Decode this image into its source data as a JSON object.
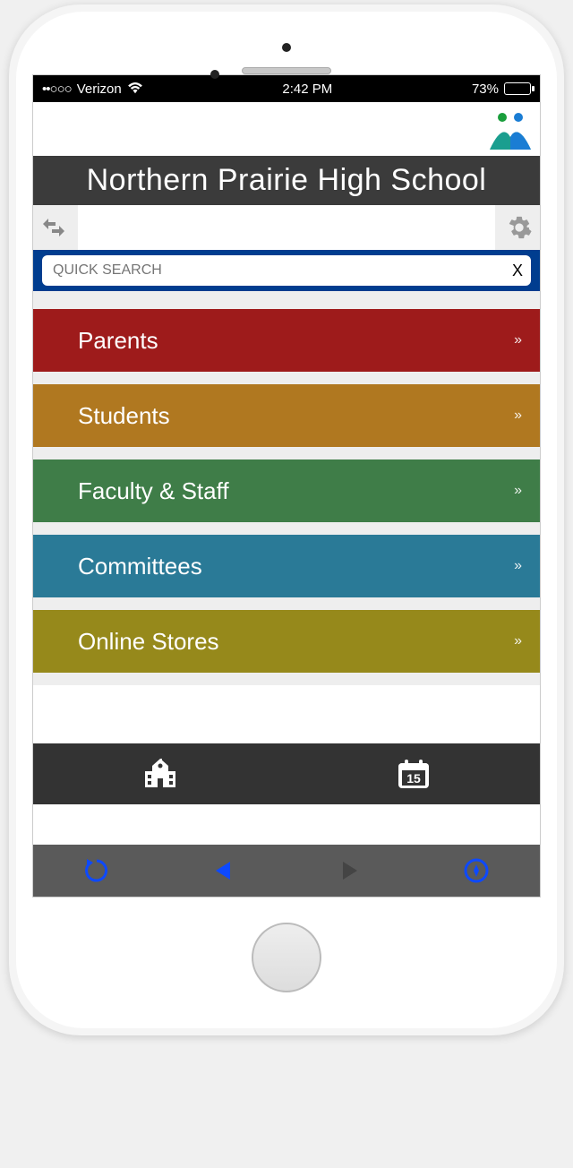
{
  "status": {
    "carrier": "Verizon",
    "time": "2:42 PM",
    "battery": "73%",
    "signal": "••○○○"
  },
  "title": "Northern Prairie High School",
  "search": {
    "placeholder": "QUICK SEARCH",
    "clear": "X"
  },
  "nav": {
    "items": [
      {
        "label": "Parents",
        "color": "c-red"
      },
      {
        "label": "Students",
        "color": "c-brown"
      },
      {
        "label": "Faculty & Staff",
        "color": "c-green"
      },
      {
        "label": "Committees",
        "color": "c-teal"
      },
      {
        "label": "Online Stores",
        "color": "c-olive"
      }
    ],
    "chevron": "»"
  },
  "footer": {
    "calendar_day": "15"
  }
}
